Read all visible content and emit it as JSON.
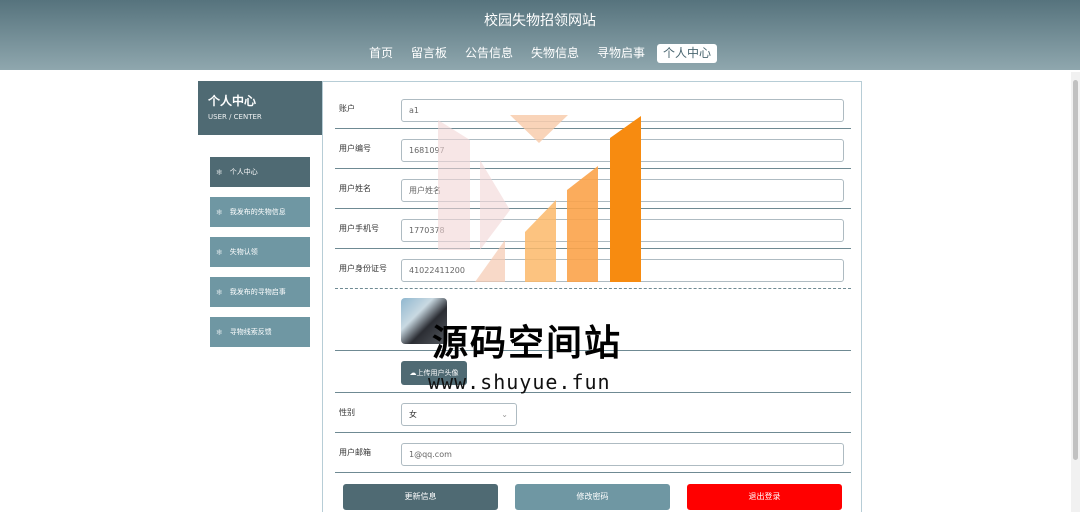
{
  "site": {
    "title": "校园失物招领网站"
  },
  "nav": [
    "首页",
    "留言板",
    "公告信息",
    "失物信息",
    "寻物启事",
    "个人中心"
  ],
  "sidebar": {
    "title": "个人中心",
    "subtitle": "USER / CENTER",
    "items": [
      "个人中心",
      "我发布的失物信息",
      "失物认领",
      "我发布的寻物启事",
      "寻物线索反馈"
    ]
  },
  "form": {
    "account": {
      "label": "账户",
      "value": "a1"
    },
    "user_no": {
      "label": "用户编号",
      "value": "1681097"
    },
    "user_name": {
      "label": "用户姓名",
      "value": "用户姓名"
    },
    "phone": {
      "label": "用户手机号",
      "value": "1770378"
    },
    "id_card": {
      "label": "用户身份证号",
      "value": "41022411200"
    },
    "upload_label": "上传用户头像",
    "gender": {
      "label": "性别",
      "value": "女"
    },
    "email": {
      "label": "用户邮箱",
      "value": "1@qq.com"
    }
  },
  "actions": {
    "update": "更新信息",
    "password": "修改密码",
    "logout": "退出登录"
  },
  "watermark": {
    "title": "源码空间站",
    "url": "www.shuyue.fun"
  },
  "colors": {
    "header": "#56737d",
    "primary": "#4f6a73",
    "secondary": "#6f97a3",
    "danger": "#ff0000"
  }
}
